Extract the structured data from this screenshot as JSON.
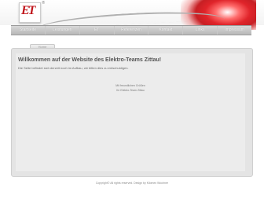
{
  "header": {
    "logo_text": "ET",
    "logo_mark": "®"
  },
  "nav": {
    "items": [
      "Startseite",
      "Leistungen",
      "ET",
      "Referenzen",
      "Kontakt",
      "Links",
      "Impressum"
    ]
  },
  "content": {
    "tab_label": "Home",
    "title": "Willkommen auf der Website des Elektro-Teams Zittau!",
    "subtitle": "Die Seite befindet sich derzeit noch im Aufbau, wir bitten dies zu entschuldigen.",
    "center_line_1": "Mit freundlichen Grüßen",
    "center_line_2": "Ihr Elektro-Team Zittau"
  },
  "footer": {
    "text": "Copyright© All rights reserved. Design by Kilomex Wochner"
  },
  "colors": {
    "brand_red": "#c0161c",
    "nav_gray": "#c8c8c8",
    "card_gray": "#e4e4e4"
  }
}
